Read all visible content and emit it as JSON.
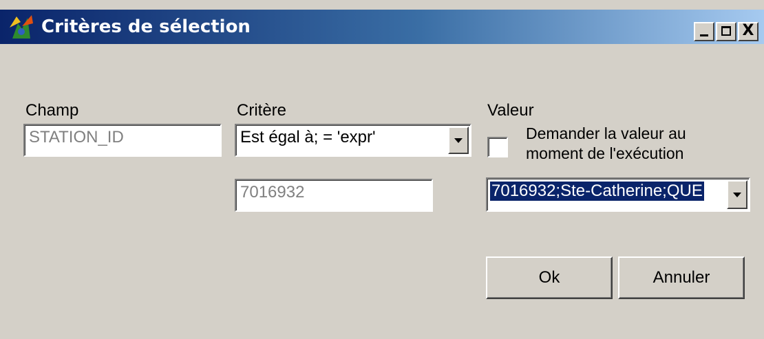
{
  "window": {
    "title": "Critères de sélection",
    "controls": {
      "minimize": "_",
      "maximize": "□",
      "close": "X"
    }
  },
  "labels": {
    "champ": "Champ",
    "critere": "Critère",
    "valeur": "Valeur"
  },
  "fields": {
    "champ_value": "STATION_ID",
    "critere_selected": "Est égal à; = 'expr'",
    "expr_value": "7016932",
    "valeur_selected": "7016932;Ste-Catherine;QUE"
  },
  "checkbox": {
    "label": "Demander la valeur au moment de l'exécution",
    "checked": false
  },
  "buttons": {
    "ok": "Ok",
    "cancel": "Annuler"
  },
  "icons": {
    "app": "app-icon",
    "dropdown": "chevron-down-icon"
  },
  "colors": {
    "titlebar_start": "#0a246a",
    "titlebar_end": "#a6caf0",
    "face": "#d4d0c8",
    "selection": "#0a246a"
  }
}
